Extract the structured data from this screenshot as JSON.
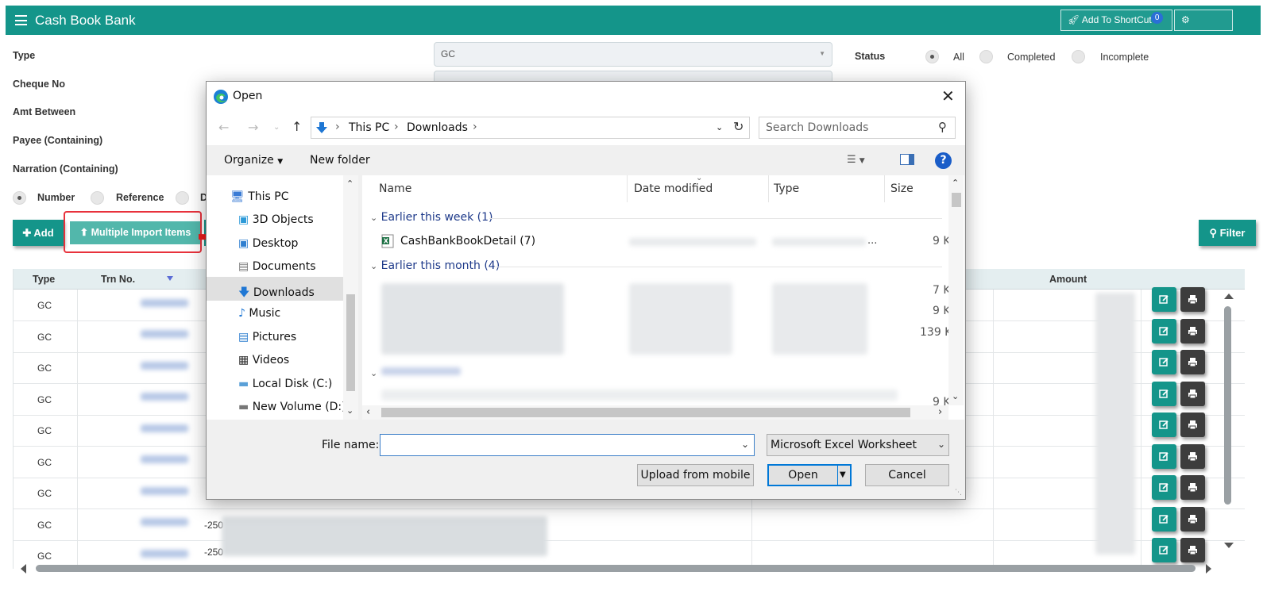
{
  "app": {
    "title": "Cash Book Bank",
    "shortcut_label": "Add To ShortCut",
    "shortcut_badge": "0",
    "settings_label": "Settings"
  },
  "form": {
    "type_label": "Type",
    "type_value": "GC",
    "cheque_label": "Cheque No",
    "amt_label": "Amt Between",
    "payee_label": "Payee (Containing)",
    "narration_label": "Narration (Containing)",
    "search_by": [
      "Number",
      "Reference",
      "D"
    ],
    "status_label": "Status",
    "status_options": [
      "All",
      "Completed",
      "Incomplete"
    ]
  },
  "actions": {
    "add": "Add",
    "multiple_import": "Multiple Import Items",
    "filter": "Filter"
  },
  "grid": {
    "columns": [
      "Type",
      "Trn No.",
      "Amount"
    ],
    "rows": [
      {
        "type": "GC",
        "ref": ""
      },
      {
        "type": "GC",
        "ref": ""
      },
      {
        "type": "GC",
        "ref": ""
      },
      {
        "type": "GC",
        "ref": ""
      },
      {
        "type": "GC",
        "ref": ""
      },
      {
        "type": "GC",
        "ref": ""
      },
      {
        "type": "GC",
        "ref": ""
      },
      {
        "type": "GC",
        "ref": "-250"
      },
      {
        "type": "GC",
        "ref": "-250"
      }
    ]
  },
  "dialog": {
    "title": "Open",
    "breadcrumb": [
      "This PC",
      "Downloads"
    ],
    "search_placeholder": "Search Downloads",
    "organize": "Organize",
    "new_folder": "New folder",
    "nav_items": [
      "This PC",
      "3D Objects",
      "Desktop",
      "Documents",
      "Downloads",
      "Music",
      "Pictures",
      "Videos",
      "Local Disk (C:)",
      "New Volume (D:)"
    ],
    "selected_nav": "Downloads",
    "columns": [
      "Name",
      "Date modified",
      "Type",
      "Size"
    ],
    "groups": [
      {
        "label": "Earlier this week (1)"
      },
      {
        "label": "Earlier this month (4)"
      }
    ],
    "visible_file": {
      "name": "CashBankBookDetail (7)",
      "type_tail": "...",
      "size": "9 K"
    },
    "other_sizes": [
      "7 K",
      "9 K",
      "139 K",
      "9 K"
    ],
    "file_name_label": "File name:",
    "file_name_value": "",
    "file_type": "Microsoft Excel Worksheet",
    "upload_mobile": "Upload from mobile",
    "open": "Open",
    "cancel": "Cancel"
  }
}
